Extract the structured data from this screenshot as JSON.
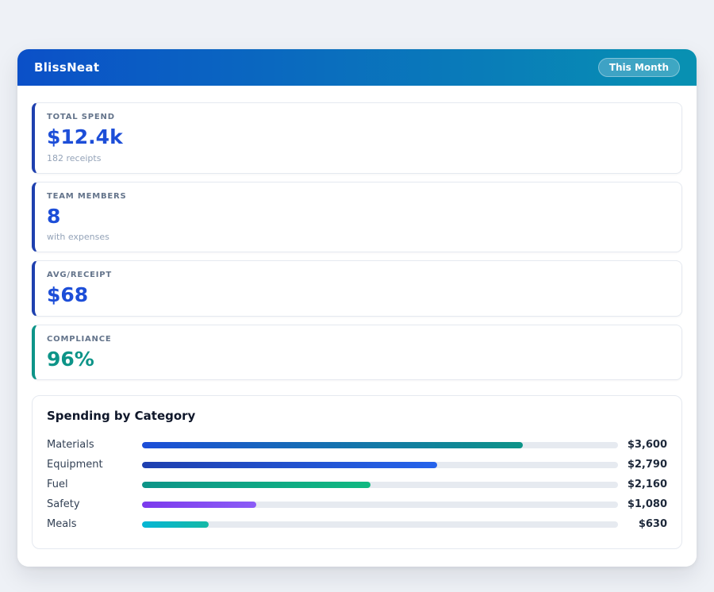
{
  "header": {
    "title": "BlissNeat",
    "badge": "This Month"
  },
  "colors": {
    "header_gradient_from": "#0b50c8",
    "header_gradient_to": "#0891b2",
    "page_background": "#eef1f6"
  },
  "stats": [
    {
      "label": "TOTAL SPEND",
      "value": "$12.4k",
      "sub": "182 receipts",
      "accent": "#1e40af",
      "value_color": "#1d4ed8"
    },
    {
      "label": "TEAM MEMBERS",
      "value": "8",
      "sub": "with expenses",
      "accent": "#1e40af",
      "value_color": "#1d4ed8"
    },
    {
      "label": "AVG/RECEIPT",
      "value": "$68",
      "sub": "",
      "accent": "#1e40af",
      "value_color": "#1d4ed8"
    },
    {
      "label": "COMPLIANCE",
      "value": "96%",
      "sub": "",
      "accent": "#0d9488",
      "value_color": "#0d9488"
    }
  ],
  "chart_data": {
    "type": "bar",
    "title": "Spending by Category",
    "categories": [
      "Materials",
      "Equipment",
      "Fuel",
      "Safety",
      "Meals"
    ],
    "values": [
      3600,
      2790,
      2160,
      1080,
      630
    ],
    "value_labels": [
      "$3,600",
      "$2,790",
      "$2,160",
      "$1,080",
      "$630"
    ],
    "xlim": [
      0,
      4500
    ],
    "orientation": "horizontal",
    "grid": false,
    "bar_colors": [
      [
        "#1d4ed8",
        "#0d9488"
      ],
      [
        "#1e40af",
        "#2563eb"
      ],
      [
        "#0d9488",
        "#10b981"
      ],
      [
        "#7c3aed",
        "#8b5cf6"
      ],
      [
        "#06b6d4",
        "#14b8a6"
      ]
    ]
  }
}
